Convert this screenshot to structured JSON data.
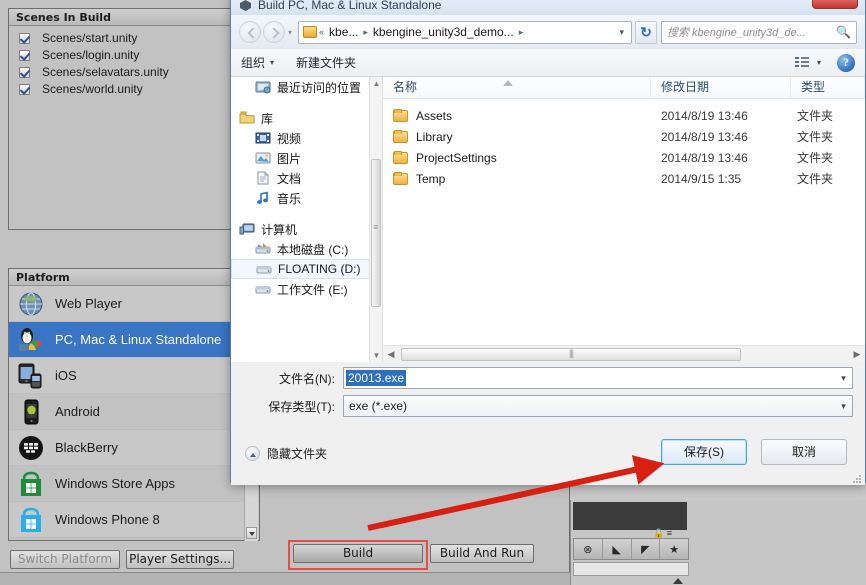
{
  "unity": {
    "scenes_panel": {
      "header": "Scenes In Build",
      "scenes": [
        {
          "label": "Scenes/start.unity",
          "checked": true
        },
        {
          "label": "Scenes/login.unity",
          "checked": true
        },
        {
          "label": "Scenes/selavatars.unity",
          "checked": true
        },
        {
          "label": "Scenes/world.unity",
          "checked": true
        }
      ]
    },
    "platform_panel": {
      "header": "Platform",
      "platforms": [
        {
          "label": "Web Player",
          "icon": "web-player-icon",
          "selected": false
        },
        {
          "label": "PC, Mac & Linux Standalone",
          "icon": "standalone-icon",
          "selected": true
        },
        {
          "label": "iOS",
          "icon": "ios-icon",
          "selected": false
        },
        {
          "label": "Android",
          "icon": "android-icon",
          "selected": false
        },
        {
          "label": "BlackBerry",
          "icon": "blackberry-icon",
          "selected": false
        },
        {
          "label": "Windows Store Apps",
          "icon": "windows-store-icon",
          "selected": false
        },
        {
          "label": "Windows Phone 8",
          "icon": "windows-phone-icon",
          "selected": false
        }
      ]
    },
    "buttons": {
      "switch_platform": "Switch Platform",
      "player_settings": "Player Settings...",
      "build": "Build",
      "build_and_run": "Build And Run"
    },
    "highlight_color": "#e94a4a",
    "selection_color": "#3a74c4"
  },
  "dialog": {
    "title": "Build PC, Mac & Linux Standalone",
    "address": {
      "segments": [
        "kbe...",
        "kbengine_unity3d_demo..."
      ],
      "leading_chevron": "«",
      "separator": "▸",
      "dropdown_caret": "▾"
    },
    "search": {
      "placeholder": "搜索 kbengine_unity3d_de...",
      "icon": "search-icon"
    },
    "refresh_icon": "refresh-icon",
    "toolbar": {
      "organize": "组织",
      "new_folder": "新建文件夹",
      "caret": "▾",
      "view_icon": "view-mode-icon",
      "help": "?"
    },
    "nav_tree": [
      {
        "label": "最近访问的位置",
        "icon": "recent-places-icon",
        "indent": 1,
        "selected": false
      },
      {
        "label": "库",
        "icon": "library-icon",
        "indent": 0,
        "selected": false
      },
      {
        "label": "视频",
        "icon": "video-icon",
        "indent": 1,
        "selected": false
      },
      {
        "label": "图片",
        "icon": "pictures-icon",
        "indent": 1,
        "selected": false
      },
      {
        "label": "文档",
        "icon": "documents-icon",
        "indent": 1,
        "selected": false
      },
      {
        "label": "音乐",
        "icon": "music-icon",
        "indent": 1,
        "selected": false
      },
      {
        "label": "计算机",
        "icon": "computer-icon",
        "indent": 0,
        "selected": false
      },
      {
        "label": "本地磁盘 (C:)",
        "icon": "local-disk-icon",
        "indent": 1,
        "selected": false
      },
      {
        "label": "FLOATING (D:)",
        "icon": "drive-icon",
        "indent": 1,
        "selected": true
      },
      {
        "label": "工作文件 (E:)",
        "icon": "drive-icon",
        "indent": 1,
        "selected": false
      }
    ],
    "columns": {
      "name": "名称",
      "date": "修改日期",
      "type": "类型"
    },
    "files": [
      {
        "name": "Assets",
        "date": "2014/8/19 13:46",
        "type": "文件夹"
      },
      {
        "name": "Library",
        "date": "2014/8/19 13:46",
        "type": "文件夹"
      },
      {
        "name": "ProjectSettings",
        "date": "2014/8/19 13:46",
        "type": "文件夹"
      },
      {
        "name": "Temp",
        "date": "2014/9/15 1:35",
        "type": "文件夹"
      }
    ],
    "fields": {
      "filename_label": "文件名(N):",
      "filename_value": "20013.exe",
      "savetype_label": "保存类型(T):",
      "savetype_value": "exe (*.exe)"
    },
    "footer": {
      "hide_folders": "隐藏文件夹",
      "save": "保存(S)",
      "cancel": "取消"
    }
  }
}
